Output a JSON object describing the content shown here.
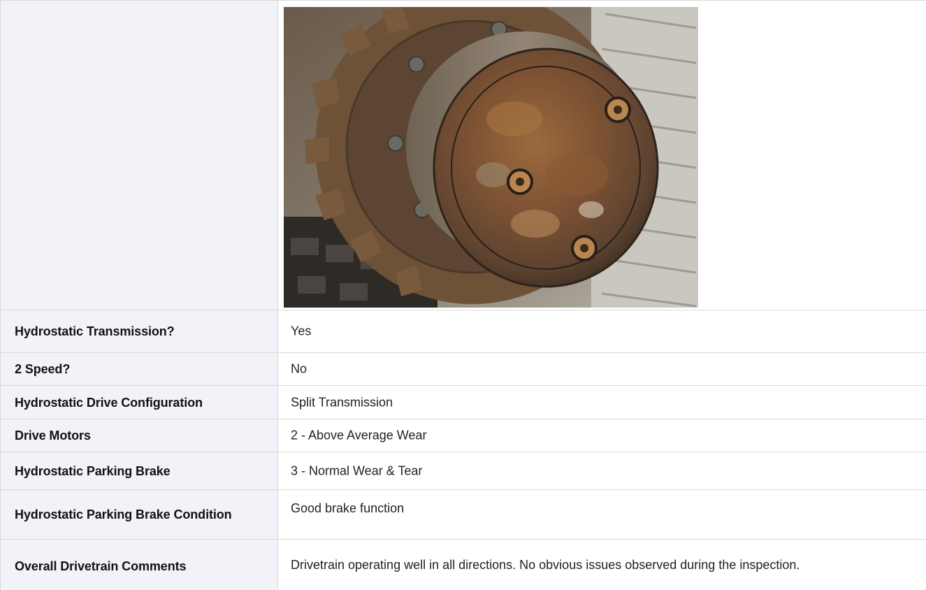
{
  "image": {
    "icon": "drive-motor-photo",
    "alt": ""
  },
  "rows": [
    {
      "label": "Hydrostatic Transmission?",
      "value": "Yes"
    },
    {
      "label": "2 Speed?",
      "value": "No"
    },
    {
      "label": "Hydrostatic Drive Configuration",
      "value": "Split Transmission"
    },
    {
      "label": "Drive Motors",
      "value": "2 - Above Average Wear"
    },
    {
      "label": "Hydrostatic Parking Brake",
      "value": "3 - Normal Wear & Tear"
    },
    {
      "label": "Hydrostatic Parking Brake Condition",
      "value": "Good brake function"
    },
    {
      "label": "Overall Drivetrain Comments",
      "value": "Drivetrain operating well in all directions. No obvious issues observed during the inspection."
    }
  ]
}
